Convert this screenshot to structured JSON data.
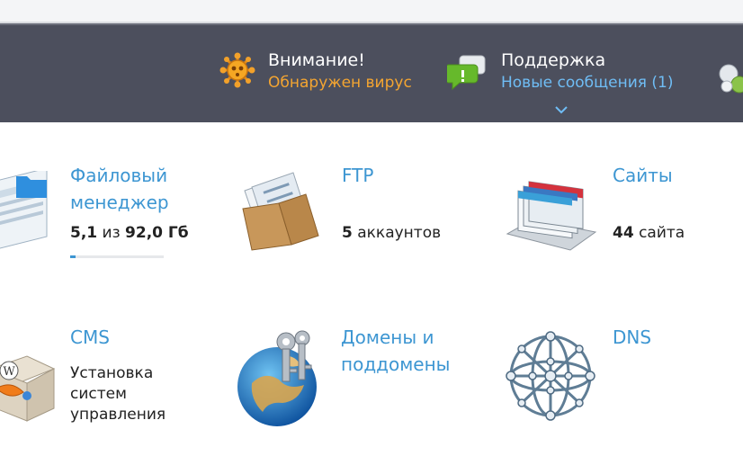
{
  "header": {
    "alert": {
      "title": "Внимание!",
      "subtitle": "Обнаружен вирус"
    },
    "support": {
      "title": "Поддержка",
      "subtitle": "Новые сообщения (1)"
    }
  },
  "tiles": [
    {
      "title_line1": "Файловый",
      "title_line2": "менеджер",
      "stat_used": "5,1",
      "stat_mid": "из",
      "stat_total": "92,0 Гб",
      "usage_fraction": 0.055
    },
    {
      "title": "FTP",
      "stat_count": "5",
      "stat_label": "аккаунтов"
    },
    {
      "title": "Сайты",
      "stat_count": "44",
      "stat_label": "сайта"
    },
    {
      "title": "CMS",
      "desc_line1": "Установка",
      "desc_line2": "систем",
      "desc_line3": "управления"
    },
    {
      "title_line1": "Домены и",
      "title_line2": "поддомены"
    },
    {
      "title": "DNS"
    }
  ],
  "colors": {
    "header_bg": "#4c4f5d",
    "link": "#3d96d2",
    "warning": "#f4a531",
    "support_link": "#6fbdf5"
  },
  "icons": [
    "virus-icon",
    "chat-bubbles-icon",
    "chevron-down-icon",
    "file-manager-icon",
    "ftp-folder-icon",
    "sites-icon",
    "cms-box-icon",
    "domains-globe-keys-icon",
    "dns-network-sphere-icon"
  ]
}
